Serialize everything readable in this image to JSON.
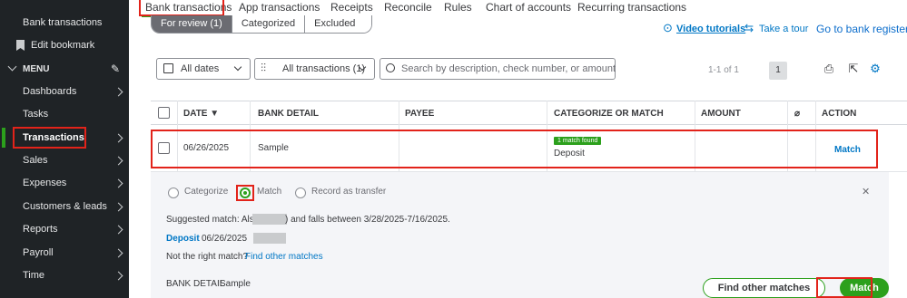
{
  "sidebar": {
    "items": [
      {
        "label": "Bank transactions"
      },
      {
        "label": "Edit bookmark"
      },
      {
        "label": "MENU"
      },
      {
        "label": "Dashboards"
      },
      {
        "label": "Tasks"
      },
      {
        "label": "Transactions"
      },
      {
        "label": "Sales"
      },
      {
        "label": "Expenses"
      },
      {
        "label": "Customers & leads"
      },
      {
        "label": "Reports"
      },
      {
        "label": "Payroll"
      },
      {
        "label": "Time"
      }
    ],
    "active": "Transactions",
    "accent_color": "#2ca01c"
  },
  "tabs": [
    {
      "label": "Bank transactions"
    },
    {
      "label": "App transactions"
    },
    {
      "label": "Receipts"
    },
    {
      "label": "Reconcile"
    },
    {
      "label": "Rules"
    },
    {
      "label": "Chart of accounts"
    },
    {
      "label": "Recurring transactions"
    }
  ],
  "segments": [
    {
      "label": "For review (1)"
    },
    {
      "label": "Categorized"
    },
    {
      "label": "Excluded"
    }
  ],
  "links": {
    "video": "Video tutorials",
    "tour": "Take a tour",
    "register": "Go to bank register"
  },
  "filters": {
    "dates": "All dates",
    "transactions": "All transactions (1)",
    "search_placeholder": "Search by description, check number, or amount"
  },
  "pagination": {
    "range": "1-1 of 1",
    "page": "1"
  },
  "table": {
    "headers": [
      "DATE",
      "BANK DETAIL",
      "PAYEE",
      "CATEGORIZE OR MATCH",
      "AMOUNT",
      "ACTION"
    ],
    "row": {
      "date": "06/26/2025",
      "bank_detail": "Sample",
      "payee": "",
      "badge": "1 match found",
      "category": "Deposit",
      "amount": "",
      "action": "Match"
    }
  },
  "panel": {
    "options": [
      "Categorize",
      "Match",
      "Record as transfer"
    ],
    "selected": "Match",
    "suggested_prefix": "Suggested match: Also",
    "suggested_suffix": ") and falls between 3/28/2025-7/16/2025.",
    "match_type": "Deposit",
    "match_date": "06/26/2025",
    "not_right": "Not the right match?",
    "find_link": "Find other matches",
    "bank_detail_label": "BANK DETAIL",
    "bank_detail_value": "Sample",
    "find_button": "Find other matches",
    "match_button": "Match"
  },
  "colors": {
    "highlight": "#e2231a",
    "green": "#2ca01c",
    "link": "#0077c5"
  }
}
